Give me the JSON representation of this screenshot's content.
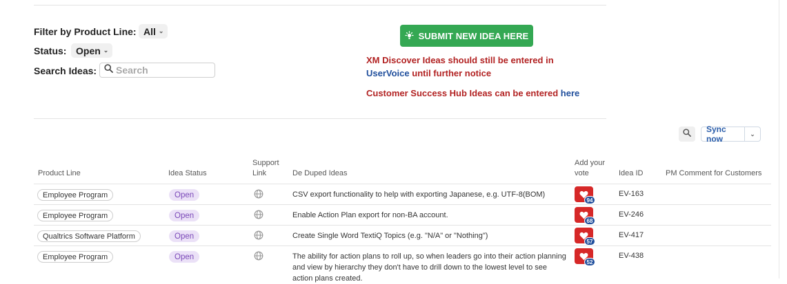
{
  "filters": {
    "product_line_label": "Filter by Product Line:",
    "product_line_value": "All",
    "status_label": "Status:",
    "status_value": "Open",
    "search_label": "Search Ideas:",
    "search_placeholder": "Search"
  },
  "submit": {
    "label": "SUBMIT NEW IDEA HERE"
  },
  "notices": {
    "xm_line1": "XM Discover Ideas should still be entered in",
    "xm_link": "UserVoice",
    "xm_line2_rest": " until further notice",
    "cs_text": "Customer Success Hub Ideas can be entered ",
    "cs_link": "here"
  },
  "toolbar": {
    "sync_label": "Sync now"
  },
  "table": {
    "headers": {
      "product_line": "Product Line",
      "idea_status": "Idea Status",
      "support_link_1": "Support",
      "support_link_2": "Link",
      "de_duped": "De Duped Ideas",
      "vote_1": "Add your",
      "vote_2": "vote",
      "idea_id": "Idea ID",
      "pm_comment": "PM Comment for Customers"
    },
    "rows": [
      {
        "product_line": "Employee Program",
        "status": "Open",
        "idea": "CSV export functionality to help with exporting Japanese, e.g. UTF-8(BOM)",
        "votes": "94",
        "id": "EV-163"
      },
      {
        "product_line": "Employee Program",
        "status": "Open",
        "idea": "Enable Action Plan export for non-BA account.",
        "votes": "68",
        "id": "EV-246"
      },
      {
        "product_line": "Qualtrics Software Platform",
        "status": "Open",
        "idea": "Create Single Word TextiQ Topics (e.g. \"N/A\" or \"Nothing\")",
        "votes": "57",
        "id": "EV-417"
      },
      {
        "product_line": "Employee Program",
        "status": "Open",
        "idea": "The ability for action plans to roll up, so when leaders go into their action planning and view by hierarchy they don't have to drill down to the lowest level to see action plans created.",
        "votes": "52",
        "id": "EV-438"
      }
    ]
  },
  "colors": {
    "submit_green": "#34a853",
    "notice_red": "#b22222",
    "link_blue": "#1f4e9c",
    "vote_red": "#d62828",
    "status_purple": "#7a48b8"
  }
}
